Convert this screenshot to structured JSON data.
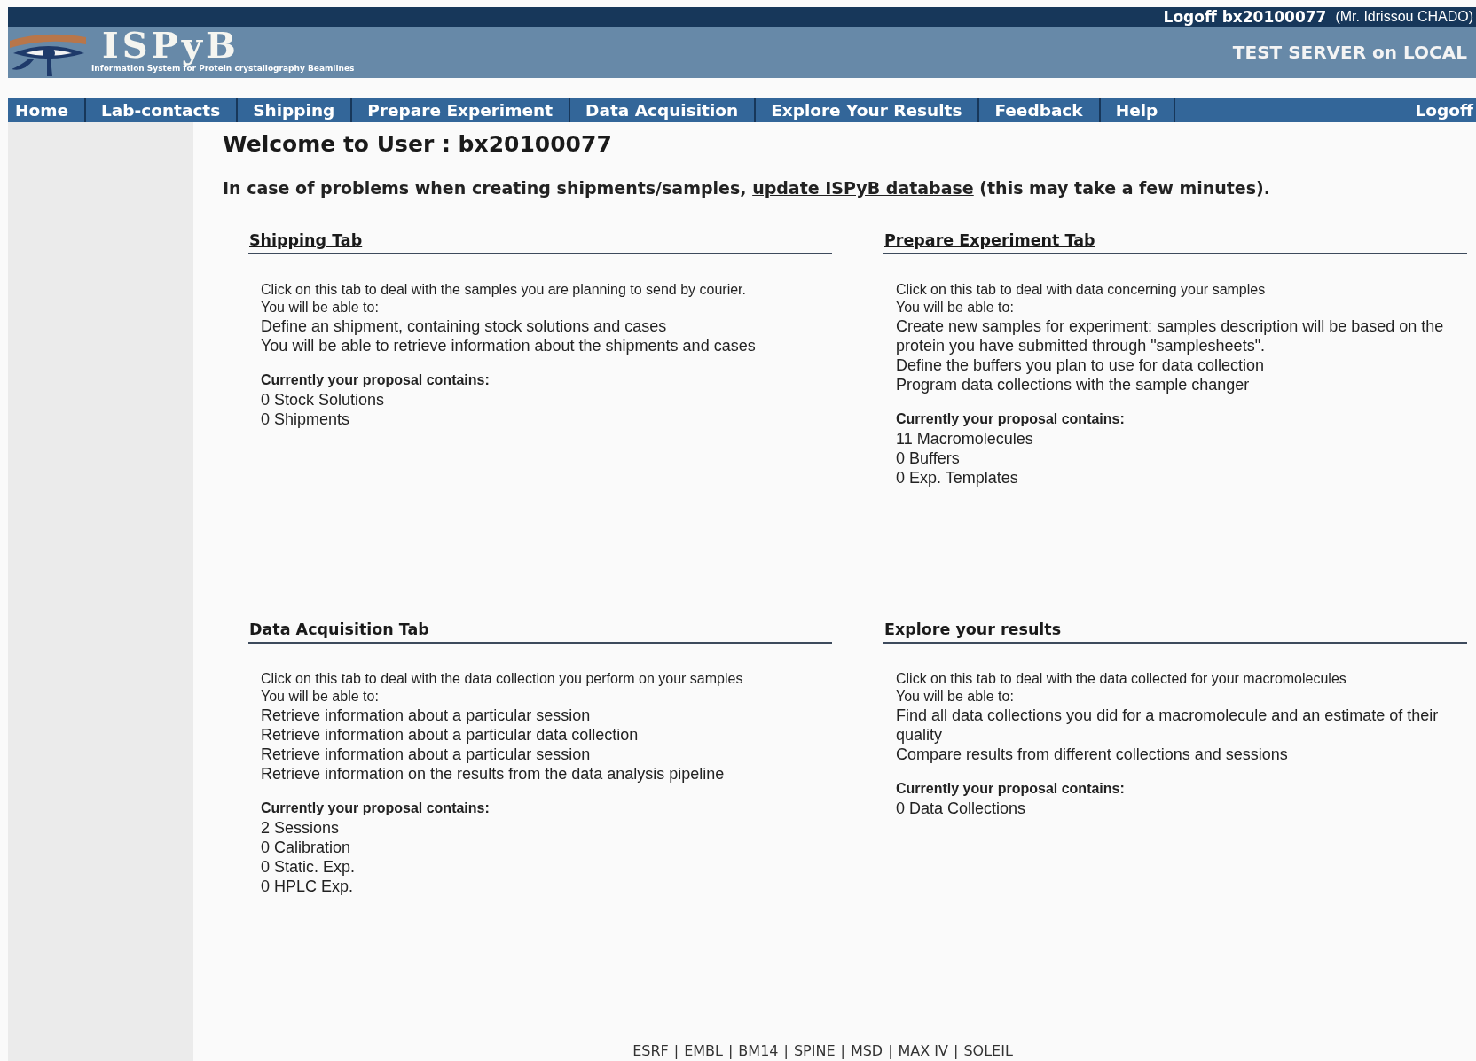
{
  "top_bar": {
    "logoff": "Logoff bx20100077",
    "user": "(Mr. Idrissou CHADO)"
  },
  "header": {
    "logo_title": "ISPyB",
    "logo_subtitle": "Information System for Protein crystallography Beamlines",
    "server": "TEST SERVER on LOCAL"
  },
  "nav": {
    "items": [
      "Home",
      "Lab-contacts",
      "Shipping",
      "Prepare Experiment",
      "Data Acquisition",
      "Explore Your Results",
      "Feedback",
      "Help"
    ],
    "logoff": "Logoff"
  },
  "welcome": "Welcome to User : bx20100077",
  "notice": {
    "before": "In case of problems when creating shipments/samples, ",
    "link": "update ISPyB database",
    "after": " (this may take a few minutes)."
  },
  "sections": [
    {
      "title": "Shipping Tab",
      "intro": [
        "Click on this tab to deal with the samples you are planning to send by courier.",
        "You will be able to:"
      ],
      "items": [
        "Define an shipment, containing stock solutions and cases",
        "You will be able to retrieve information about the shipments and cases"
      ],
      "summary_title": "Currently your proposal contains:",
      "summary": [
        "0 Stock Solutions",
        "0 Shipments"
      ]
    },
    {
      "title": "Prepare Experiment Tab",
      "intro": [
        "Click on this tab to deal with data concerning your samples",
        "You will be able to:"
      ],
      "items": [
        "Create new samples for experiment: samples description will be based on the protein you have submitted through \"samplesheets\".",
        "Define the buffers you plan to use for data collection",
        "Program data collections with the sample changer"
      ],
      "summary_title": "Currently your proposal contains:",
      "summary": [
        "11 Macromolecules",
        "0 Buffers",
        "0 Exp. Templates"
      ]
    },
    {
      "title": "Data Acquisition Tab",
      "intro": [
        "Click on this tab to deal with the data collection you perform on your samples",
        "You will be able to:"
      ],
      "items": [
        "Retrieve information about a particular session",
        "Retrieve information about a particular data collection",
        "Retrieve information about a particular session",
        "Retrieve information on the results from the data analysis pipeline"
      ],
      "summary_title": "Currently your proposal contains:",
      "summary": [
        "2 Sessions",
        "0 Calibration",
        "0 Static. Exp.",
        "0 HPLC Exp."
      ]
    },
    {
      "title": "Explore your results",
      "intro": [
        "Click on this tab to deal with the data collected for your macromolecules",
        "You will be able to:"
      ],
      "items": [
        "Find all data collections you did for a macromolecule and an estimate of their quality",
        "Compare results from different collections and sessions"
      ],
      "summary_title": "Currently your proposal contains:",
      "summary": [
        "0 Data Collections"
      ]
    }
  ],
  "footer": {
    "separator": "|",
    "links": [
      "ESRF",
      "EMBL",
      "BM14",
      "SPINE",
      "MSD",
      "MAX IV",
      "SOLEIL"
    ]
  }
}
